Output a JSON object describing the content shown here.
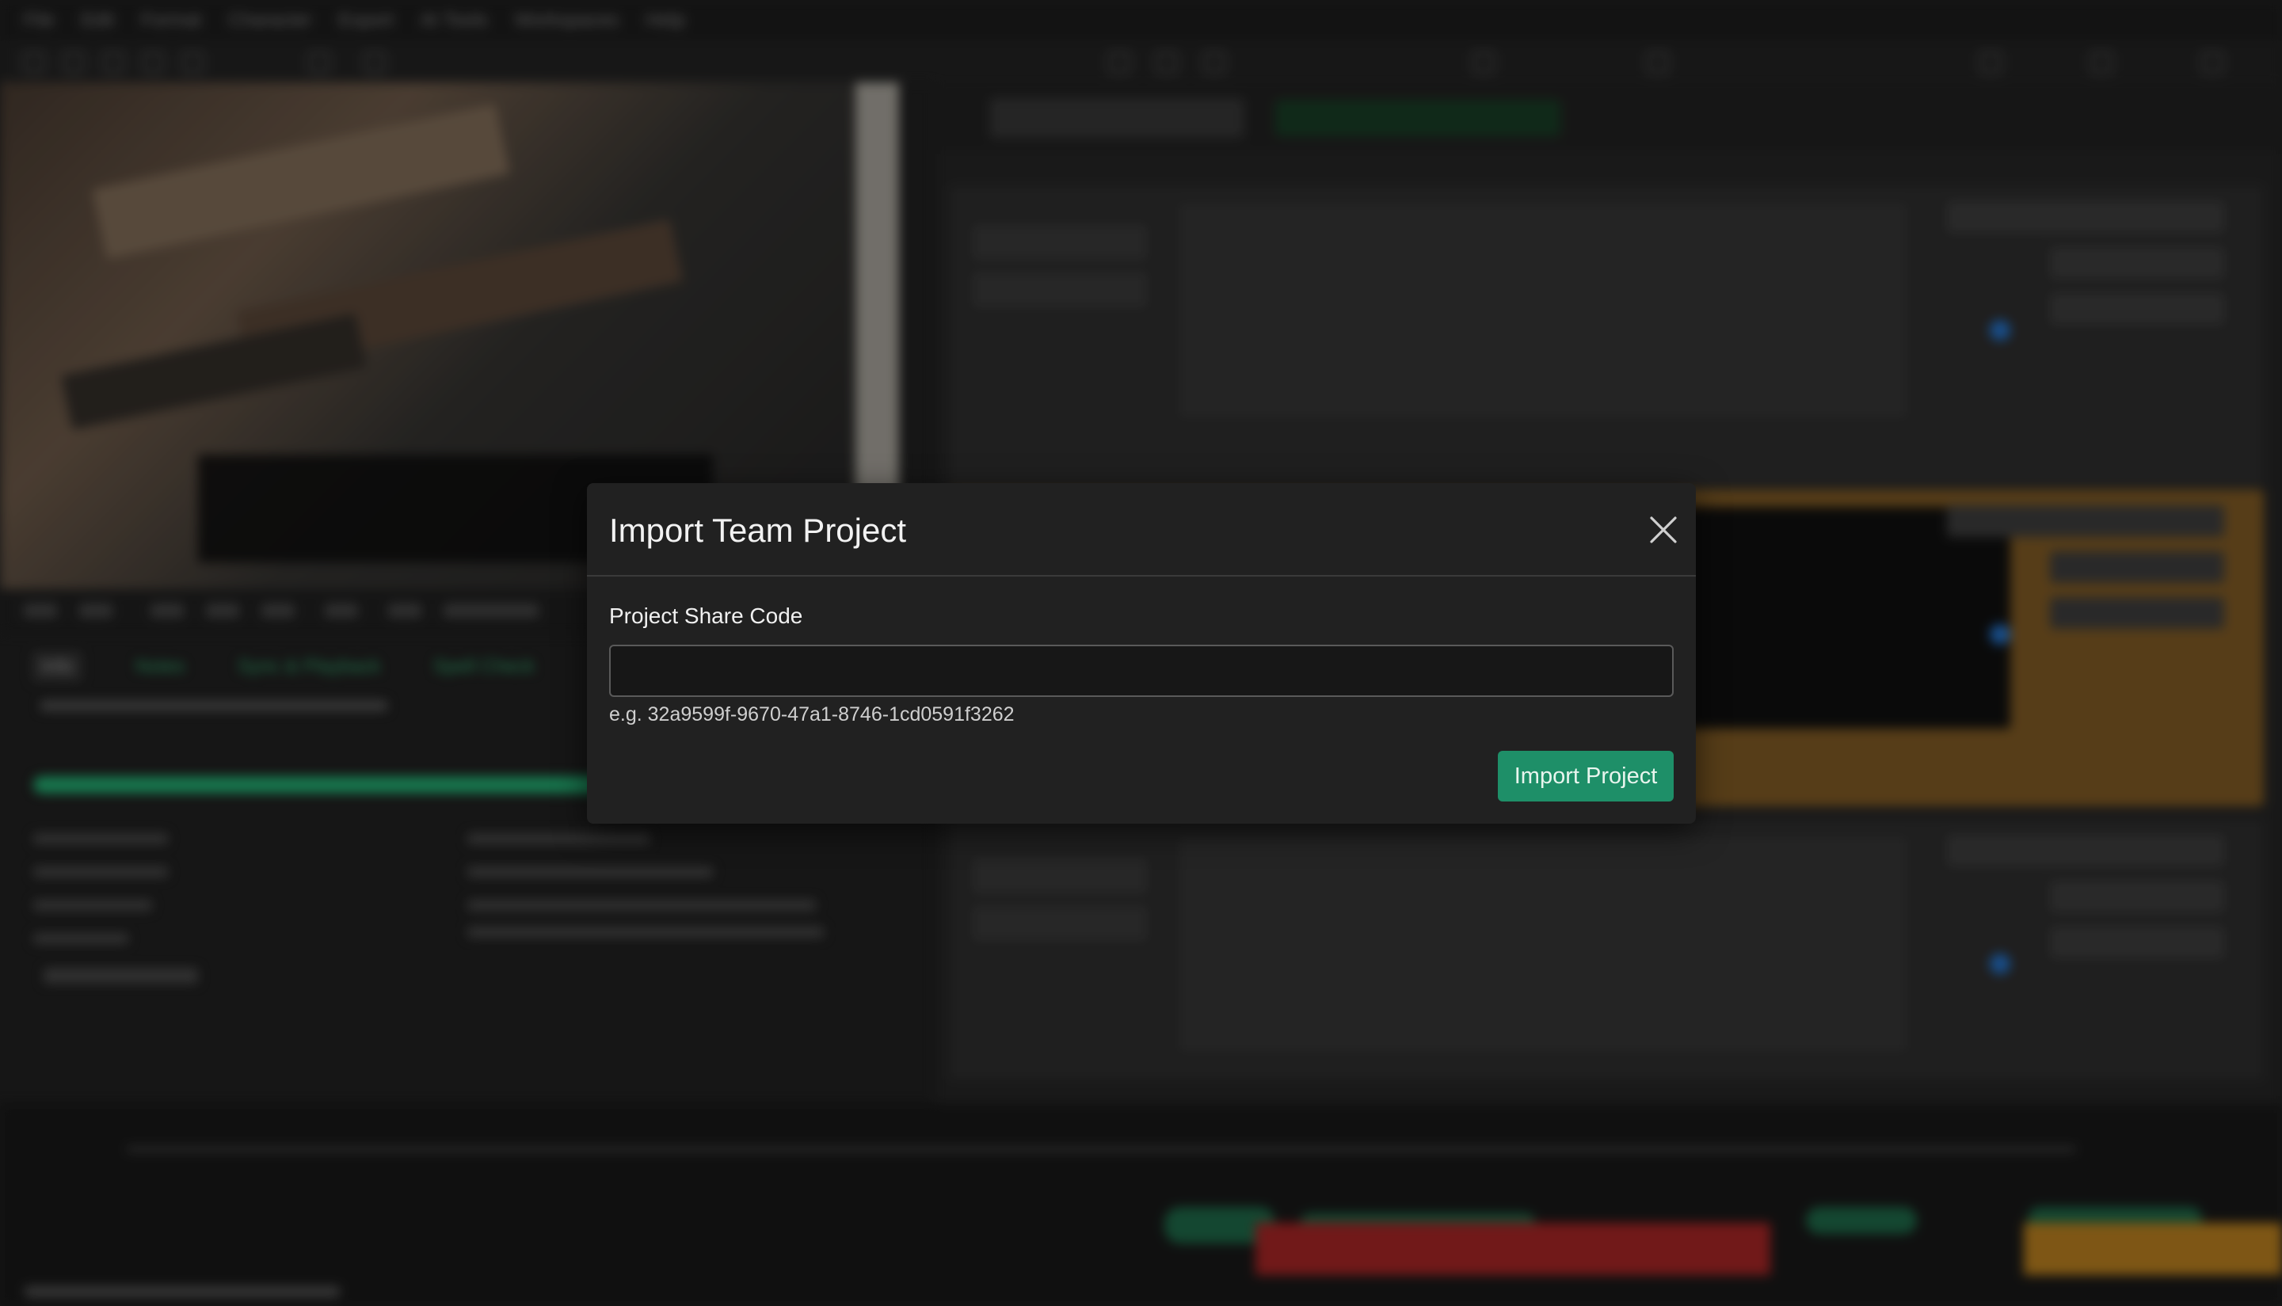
{
  "menu": [
    "File",
    "Edit",
    "Format",
    "Character",
    "Export",
    "AI Tools",
    "Workspaces",
    "Help"
  ],
  "left_tabs": [
    "Info",
    "Notes",
    "Sync & Playback",
    "Spell Check"
  ],
  "modal": {
    "title": "Import Team Project",
    "field_label": "Project Share Code",
    "input_value": "",
    "input_placeholder": "",
    "hint": "e.g. 32a9599f-9670-47a1-8746-1cd0591f3262",
    "submit_label": "Import Project",
    "close_icon": "close-icon"
  },
  "colors": {
    "accent_green": "#1e8f68",
    "modal_bg": "#212121",
    "app_bg": "#1b1b1b"
  }
}
